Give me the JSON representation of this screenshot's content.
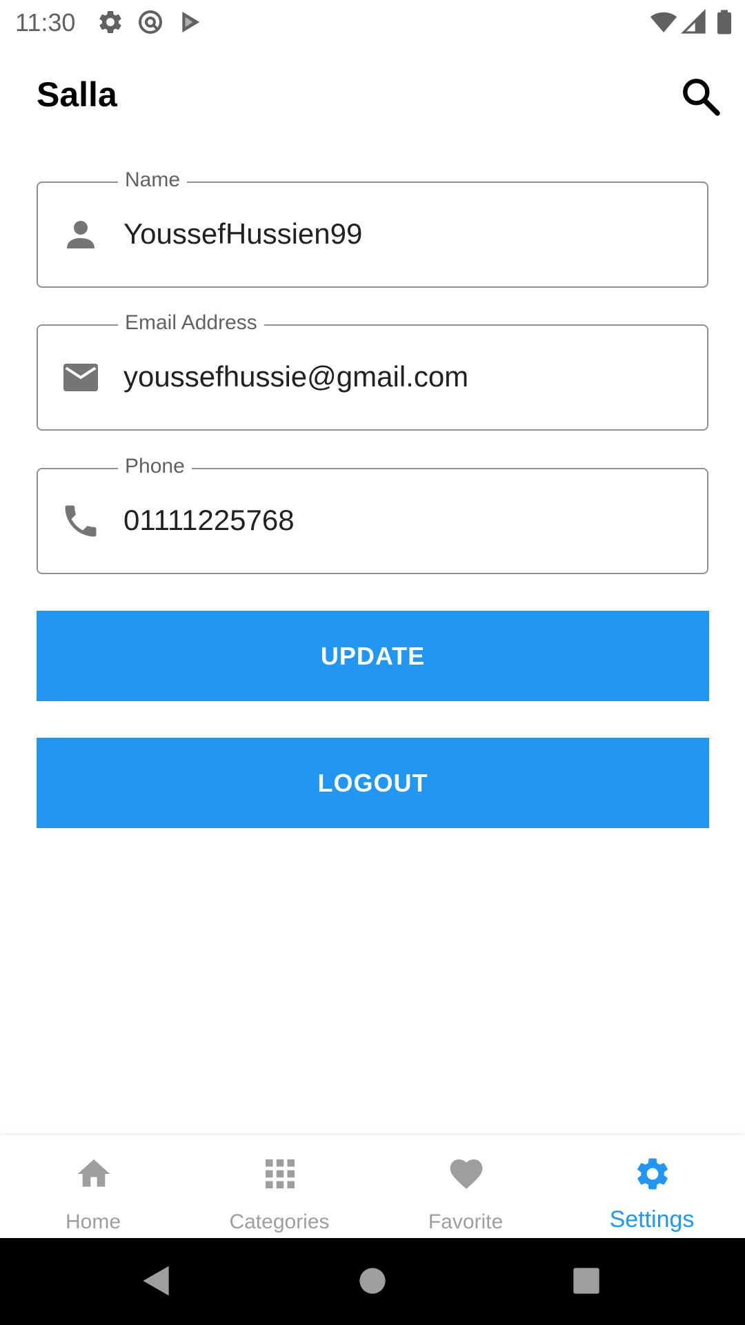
{
  "status_bar": {
    "time": "11:30",
    "left_icons": [
      "gear-icon",
      "at-sign-icon",
      "play-store-icon"
    ],
    "right_icons": [
      "wifi-icon",
      "signal-icon",
      "battery-icon"
    ]
  },
  "app_bar": {
    "title": "Salla",
    "search_icon": "search-icon"
  },
  "form": {
    "name": {
      "label": "Name",
      "value": "YoussefHussien99",
      "icon": "person-icon"
    },
    "email": {
      "label": "Email Address",
      "value": "youssefhussie@gmail.com",
      "icon": "email-icon"
    },
    "phone": {
      "label": "Phone",
      "value": "01111225768",
      "icon": "phone-icon"
    }
  },
  "buttons": {
    "update": "UPDATE",
    "logout": "LOGOUT"
  },
  "bottom_nav": {
    "items": [
      {
        "label": "Home",
        "icon": "home-icon",
        "active": false
      },
      {
        "label": "Categories",
        "icon": "grid-icon",
        "active": false
      },
      {
        "label": "Favorite",
        "icon": "heart-icon",
        "active": false
      },
      {
        "label": "Settings",
        "icon": "gear-icon",
        "active": true
      }
    ]
  },
  "colors": {
    "primary": "#2196f3",
    "inactive": "#9e9e9e",
    "border": "#8f8f8f",
    "icon_gray": "#757575"
  }
}
